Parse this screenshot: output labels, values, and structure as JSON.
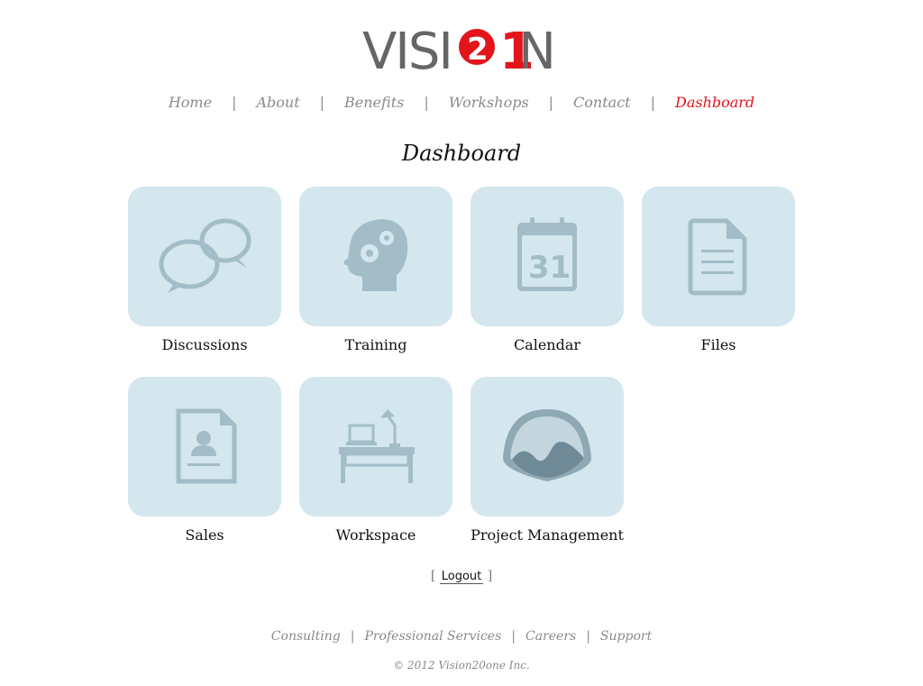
{
  "logo": {
    "text_left": "VISI",
    "text_num": "2",
    "text_num2": "1",
    "text_right": "N",
    "brand_gray": "#666666",
    "brand_red": "#e3141b"
  },
  "nav": {
    "items": [
      {
        "label": "Home",
        "active": false
      },
      {
        "label": "About",
        "active": false
      },
      {
        "label": "Benefits",
        "active": false
      },
      {
        "label": "Workshops",
        "active": false
      },
      {
        "label": "Contact",
        "active": false
      },
      {
        "label": "Dashboard",
        "active": true
      }
    ],
    "separator": "|"
  },
  "main": {
    "title": "Dashboard",
    "tiles": [
      {
        "label": "Discussions",
        "icon": "speech-bubbles-icon"
      },
      {
        "label": "Training",
        "icon": "head-gears-icon"
      },
      {
        "label": "Calendar",
        "icon": "calendar-icon",
        "icon_text": "31"
      },
      {
        "label": "Files",
        "icon": "document-icon"
      },
      {
        "label": "Sales",
        "icon": "contact-card-icon"
      },
      {
        "label": "Workspace",
        "icon": "desk-icon"
      },
      {
        "label": "Project Management",
        "icon": "basecamp-icon"
      }
    ],
    "tile_color": "#d4e6ee",
    "icon_color": "#a2bdc8"
  },
  "logout": {
    "open": "[",
    "label": "Logout",
    "close": "]"
  },
  "footer": {
    "links": [
      {
        "label": "Consulting"
      },
      {
        "label": "Professional Services"
      },
      {
        "label": "Careers"
      },
      {
        "label": "Support"
      }
    ],
    "separator": "|",
    "copyright": "© 2012 Vision20one Inc."
  }
}
